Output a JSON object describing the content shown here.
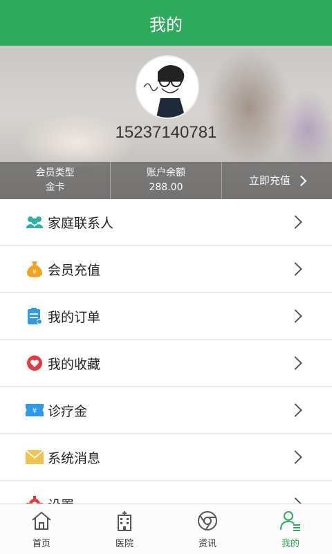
{
  "header": {
    "title": "我的"
  },
  "profile": {
    "phone": "15237140781",
    "member_type_label": "会员类型",
    "member_type_value": "金卡",
    "balance_label": "账户余额",
    "balance_value": "288.00",
    "recharge_label": "立即充值"
  },
  "menu": [
    {
      "label": "家庭联系人",
      "icon": "family-contacts-icon"
    },
    {
      "label": "会员充值",
      "icon": "money-bag-icon"
    },
    {
      "label": "我的订单",
      "icon": "order-clipboard-icon"
    },
    {
      "label": "我的收藏",
      "icon": "heart-icon"
    },
    {
      "label": "诊疗金",
      "icon": "ticket-icon"
    },
    {
      "label": "系统消息",
      "icon": "envelope-icon"
    },
    {
      "label": "设置",
      "icon": "gear-icon"
    }
  ],
  "tabbar": [
    {
      "label": "首页",
      "icon": "home-icon"
    },
    {
      "label": "医院",
      "icon": "hospital-icon"
    },
    {
      "label": "资讯",
      "icon": "news-icon"
    },
    {
      "label": "我的",
      "icon": "user-icon"
    }
  ],
  "colors": {
    "brand": "#2eaa5c"
  }
}
